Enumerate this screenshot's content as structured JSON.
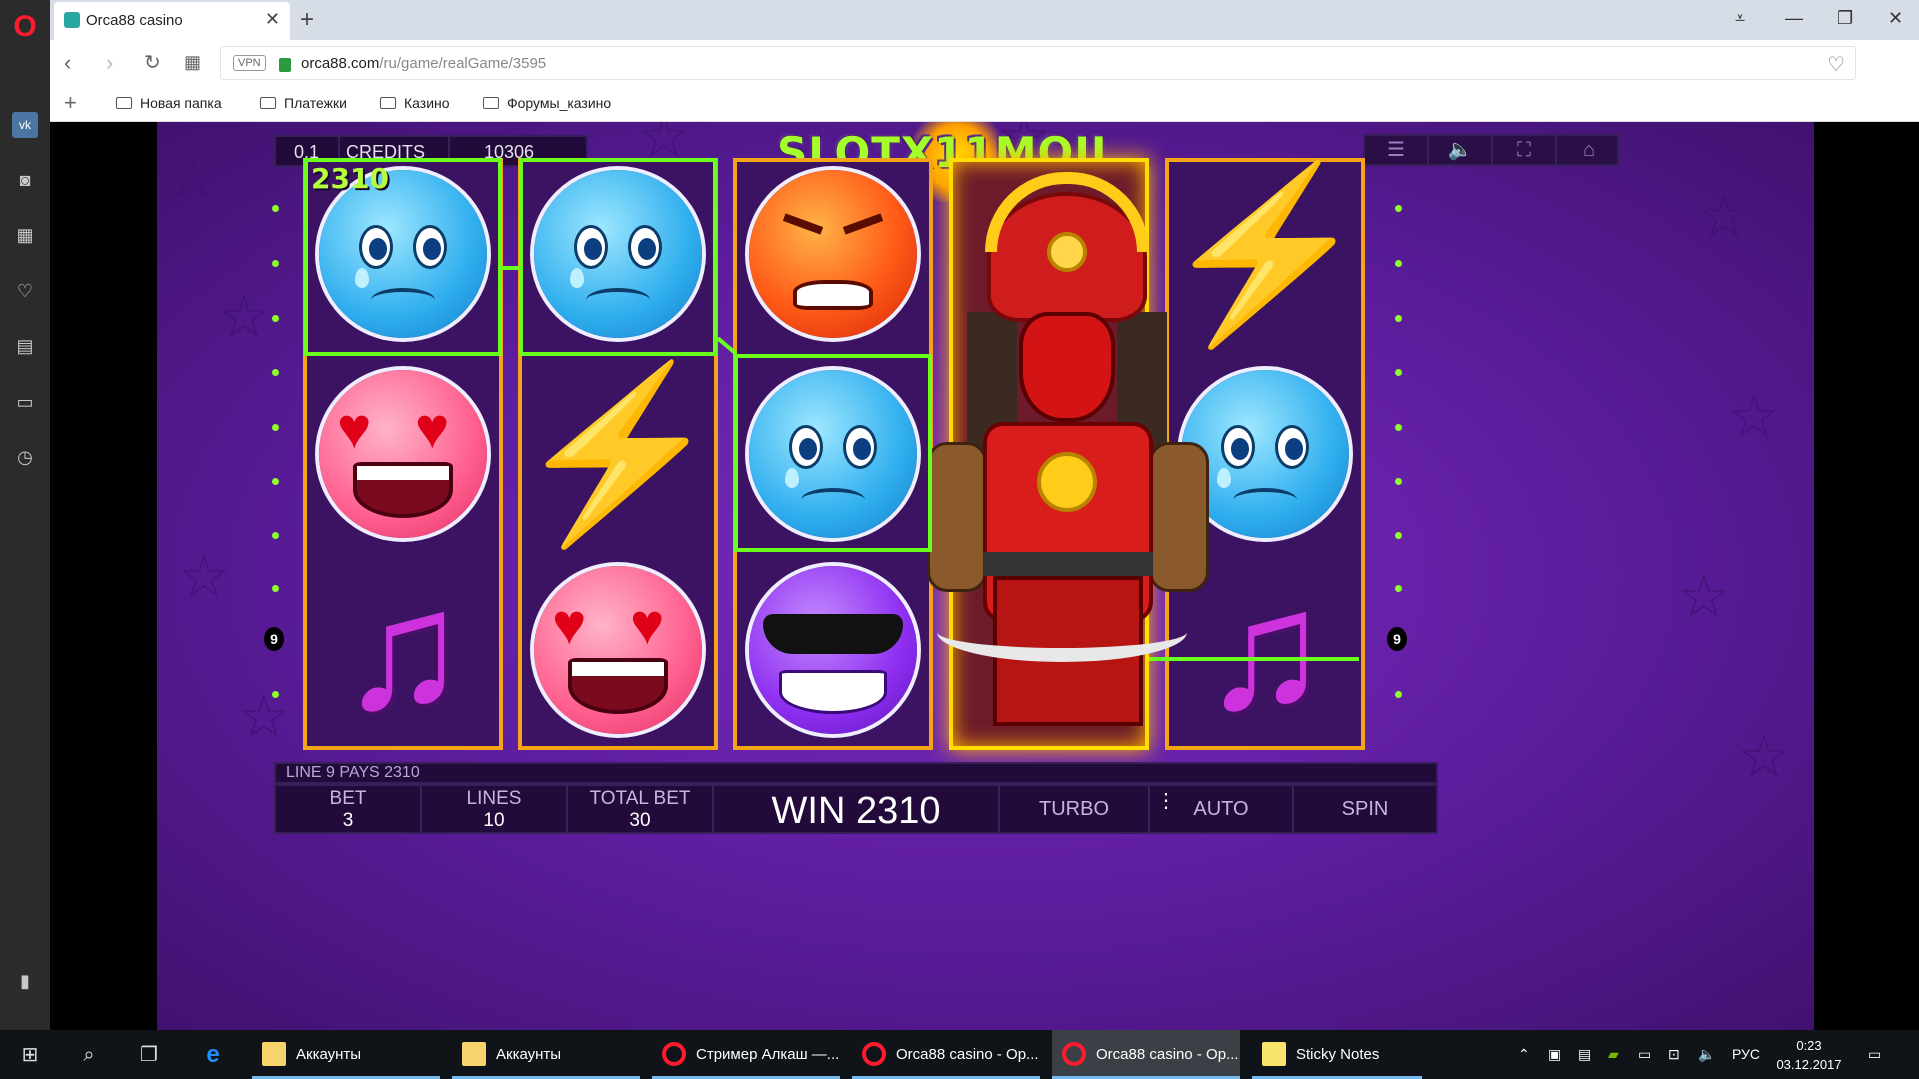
{
  "browser": {
    "tab_title": "Orca88 casino",
    "url_domain": "orca88.com",
    "url_path": "/ru/game/realGame/3595",
    "vpn_label": "VPN",
    "bookmarks": [
      "Новая папка",
      "Платежки",
      "Казино",
      "Форумы_казино"
    ]
  },
  "game": {
    "logo": "SLOTX11MOJI",
    "denomination": "0.1",
    "credits_label": "CREDITS",
    "credits_value": "10306",
    "win_amount_label": "2310",
    "line_number": "9",
    "message": "LINE 9 PAYS 2310",
    "bet_label": "BET",
    "bet_value": "3",
    "lines_label": "LINES",
    "lines_value": "10",
    "total_bet_label": "TOTAL BET",
    "total_bet_value": "30",
    "win_text": "WIN 2310",
    "turbo_label": "TURBO",
    "auto_label": "AUTO",
    "spin_label": "SPIN",
    "reels": [
      [
        "sad-face",
        "heart-eyes-face",
        "music-note"
      ],
      [
        "sad-face",
        "lightning-bolt",
        "heart-eyes-face"
      ],
      [
        "angry-face",
        "sad-face",
        "sunglasses-face"
      ],
      [
        "samurai-wild",
        "samurai-wild",
        "samurai-wild"
      ],
      [
        "lightning-bolt",
        "sad-face",
        "music-note"
      ]
    ]
  },
  "taskbar": {
    "items": [
      {
        "label": "Аккаунты"
      },
      {
        "label": "Аккаунты"
      },
      {
        "label": "Стример Алкаш —..."
      },
      {
        "label": "Orca88 casino - Op..."
      },
      {
        "label": "Orca88 casino - Op..."
      },
      {
        "label": "Sticky Notes"
      }
    ],
    "language": "РУС",
    "time": "0:23",
    "date": "03.12.2017"
  }
}
